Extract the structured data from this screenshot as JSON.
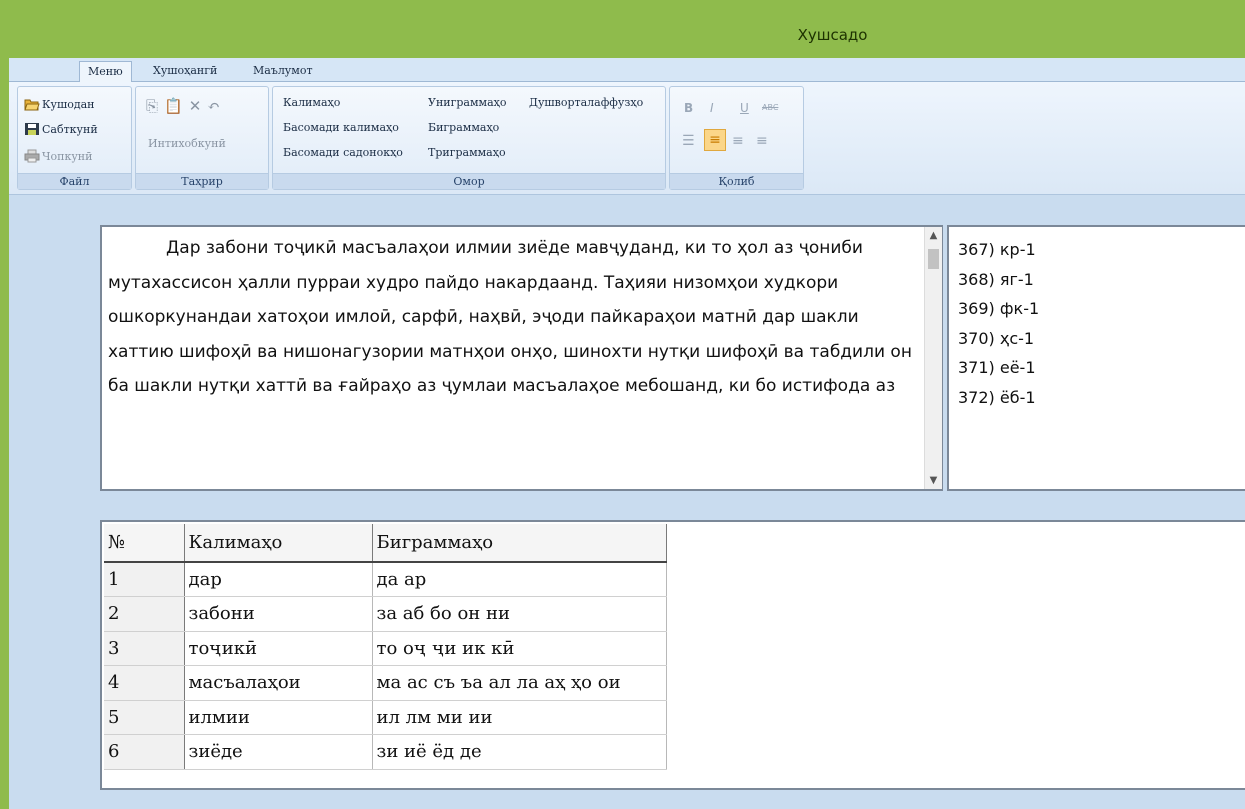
{
  "window": {
    "title": "Хушсадо"
  },
  "tabs": [
    "Меню",
    "Хушоҳангӣ",
    "Маълумот"
  ],
  "ribbon": {
    "file": {
      "label": "Файл",
      "open": "Кушодан",
      "save": "Сабткунӣ",
      "print": "Чопкунӣ"
    },
    "edit": {
      "label": "Таҳрир",
      "select_all": "Интихобкунӣ"
    },
    "stats": {
      "label": "Омор",
      "words": "Калимаҳо",
      "word_freq": "Басомади калимаҳо",
      "sound_freq": "Басомади садонокҳо",
      "unigrams": "Униграммаҳо",
      "bigrams": "Биграммаҳо",
      "trigrams": "Триграммаҳо",
      "hard_words": "Душворталаффузҳо"
    },
    "format": {
      "label": "Қолиб",
      "bold": "B",
      "italic": "I",
      "underline": "U",
      "strike": "ABC"
    }
  },
  "editor": {
    "text": "Дар забони тоҷикӣ масъалаҳои илмии зиёде мавҷуданд, ки то ҳол аз ҷониби мутахассисон ҳалли пурраи худро пайдо накардаанд. Таҳияи низомҳои худкори ошкоркунандаи хатоҳои имлоӣ, сарфӣ, наҳвӣ, эҷоди пайкараҳои матнӣ дар шакли хаттию шифоҳӣ ва нишонагузории матнҳои онҳо, шинохти нутқи шифоҳӣ ва табдили он ба шакли нутқи хаттӣ ва ғайраҳо аз ҷумлаи масъалаҳое мебошанд, ки бо истифода аз"
  },
  "bigram_list": [
    "367) кр-1",
    "368) яг-1",
    "369) фк-1",
    "370) ҳс-1",
    "371) её-1",
    "372) ёб-1"
  ],
  "table": {
    "headers": [
      "№",
      "Калимаҳо",
      "Биграммаҳо"
    ],
    "rows": [
      [
        "1",
        "дар",
        "да ар"
      ],
      [
        "2",
        "забони",
        "за аб бо он ни"
      ],
      [
        "3",
        "тоҷикӣ",
        "то оҷ ҷи ик кӣ"
      ],
      [
        "4",
        "масъалаҳои",
        "ма ас съ ъа ал ла аҳ ҳо ои"
      ],
      [
        "5",
        "илмии",
        "ил лм ми ии"
      ],
      [
        "6",
        "зиёде",
        "зи иё ёд де"
      ]
    ]
  }
}
